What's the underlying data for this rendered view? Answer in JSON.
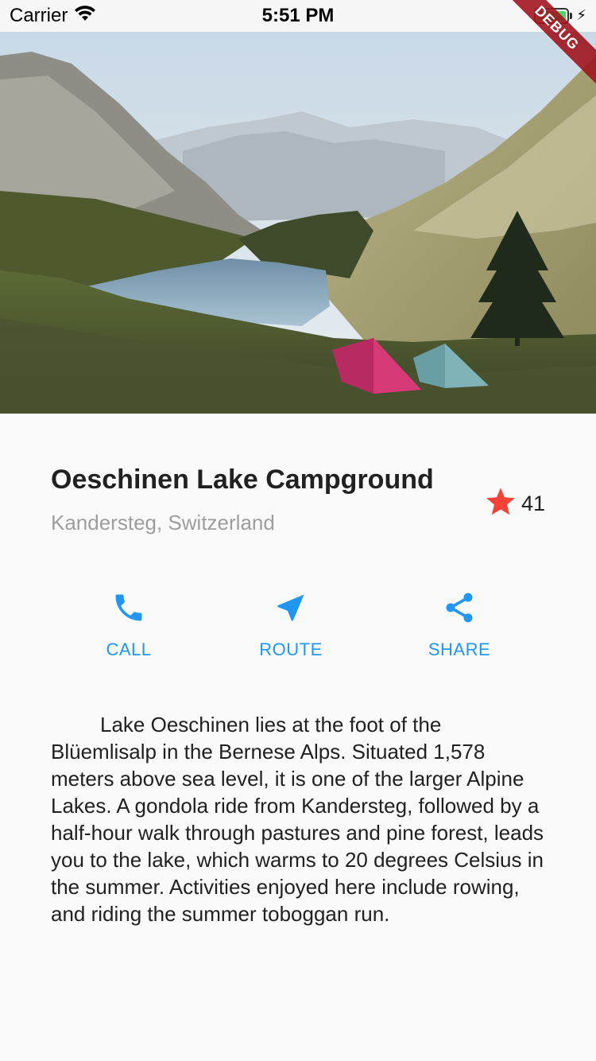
{
  "status_bar": {
    "carrier": "Carrier",
    "time": "5:51 PM",
    "battery_color": "#4cd964"
  },
  "debug_banner": "DEBUG",
  "hero": {
    "icon": "campground-lake-photo"
  },
  "place": {
    "title": "Oeschinen Lake Campground",
    "location": "Kandersteg, Switzerland",
    "rating_count": "41",
    "star_color": "#f44336"
  },
  "actions": [
    {
      "label": "CALL",
      "icon": "phone-icon"
    },
    {
      "label": "ROUTE",
      "icon": "navigation-icon"
    },
    {
      "label": "SHARE",
      "icon": "share-icon"
    }
  ],
  "accent_color": "#2196f3",
  "description": "Lake Oeschinen lies at the foot of the Blüemlisalp in the Bernese Alps. Situated 1,578 meters above sea level, it is one of the larger Alpine Lakes. A gondola ride from Kandersteg, followed by a half-hour walk through pastures and pine forest, leads you to the lake, which warms to 20 degrees Celsius in the summer. Activities enjoyed here include rowing, and riding the summer toboggan run."
}
